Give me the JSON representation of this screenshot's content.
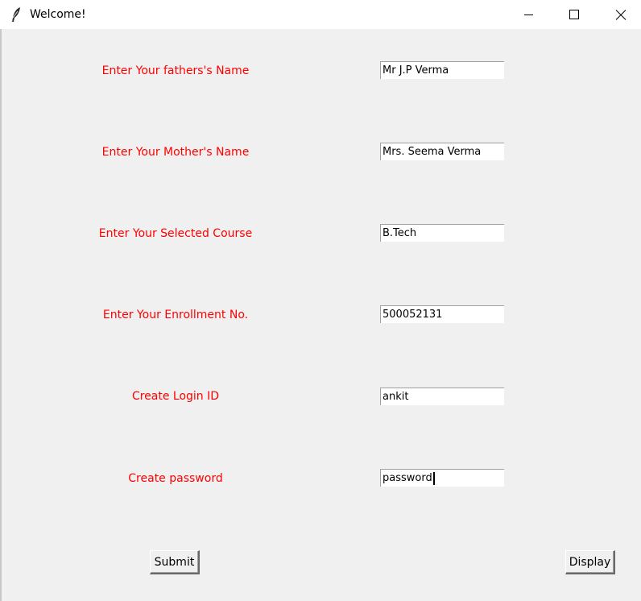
{
  "window": {
    "title": "Welcome!"
  },
  "form": {
    "fields": [
      {
        "label": "Enter Your fathers's Name",
        "value": "Mr J.P Verma"
      },
      {
        "label": "Enter Your Mother's Name",
        "value": "Mrs. Seema Verma"
      },
      {
        "label": "Enter Your Selected Course",
        "value": "B.Tech"
      },
      {
        "label": "Enter Your Enrollment No.",
        "value": "500052131"
      },
      {
        "label": "Create Login ID",
        "value": "ankit"
      },
      {
        "label": "Create password",
        "value": "password"
      }
    ],
    "submit_label": "Submit",
    "display_label": "Display"
  },
  "colors": {
    "label": "#ff0000",
    "background": "#f0f0f0",
    "titlebar": "#ffffff"
  },
  "icons": {
    "app": "feather-icon",
    "minimize": "minimize-icon",
    "maximize": "maximize-icon",
    "close": "close-icon"
  }
}
